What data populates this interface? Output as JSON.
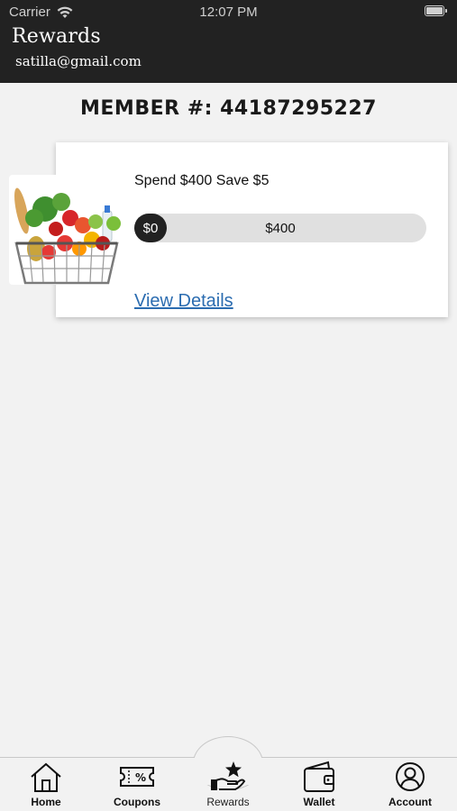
{
  "status_bar": {
    "carrier": "Carrier",
    "time": "12:07 PM",
    "icons": [
      "wifi-icon",
      "battery-icon"
    ]
  },
  "header": {
    "title": "Rewards",
    "email": "satilla@gmail.com"
  },
  "member": {
    "label": "MEMBER #: 44187295227"
  },
  "reward_card": {
    "image": "grocery-basket-image",
    "title": "Spend $400 Save $5",
    "progress": {
      "current_label": "$0",
      "target_label": "$400",
      "current_value": 0,
      "target_value": 400
    },
    "link_label": "View Details"
  },
  "tab_bar": {
    "active": "Rewards",
    "items": [
      {
        "label": "Home",
        "icon": "home-icon"
      },
      {
        "label": "Coupons",
        "icon": "coupon-icon"
      },
      {
        "label": "Rewards",
        "icon": "rewards-hand-star-icon"
      },
      {
        "label": "Wallet",
        "icon": "wallet-icon"
      },
      {
        "label": "Account",
        "icon": "account-icon"
      }
    ]
  },
  "colors": {
    "header_bg": "#222222",
    "page_bg": "#f2f2f2",
    "link": "#2b6cb0",
    "progress_track": "#e0e0e0",
    "progress_knob": "#222222"
  }
}
